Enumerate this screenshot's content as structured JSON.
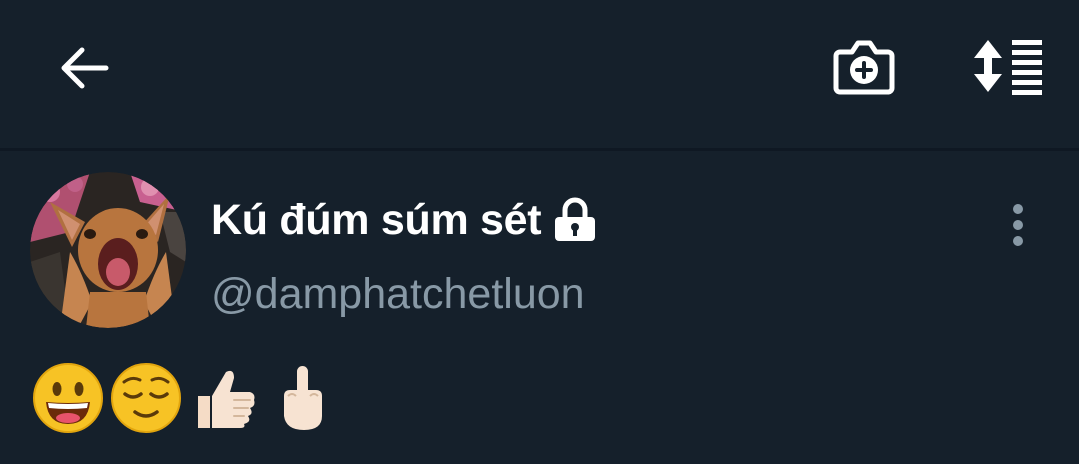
{
  "profile": {
    "display_name": "Kú đúm súm sét",
    "handle": "@damphatchetluon",
    "bio_emojis": [
      "grinning-face",
      "relieved-face",
      "thumbs-up",
      "middle-finger"
    ]
  },
  "colors": {
    "background": "#15202b",
    "primary_text": "#ffffff",
    "secondary_text": "#8899a6",
    "icon": "#ffffff"
  },
  "icons": {
    "back": "back-arrow-icon",
    "camera": "add-photo-icon",
    "sort": "sort-list-icon",
    "lock": "lock-icon",
    "more": "more-vertical-icon"
  }
}
